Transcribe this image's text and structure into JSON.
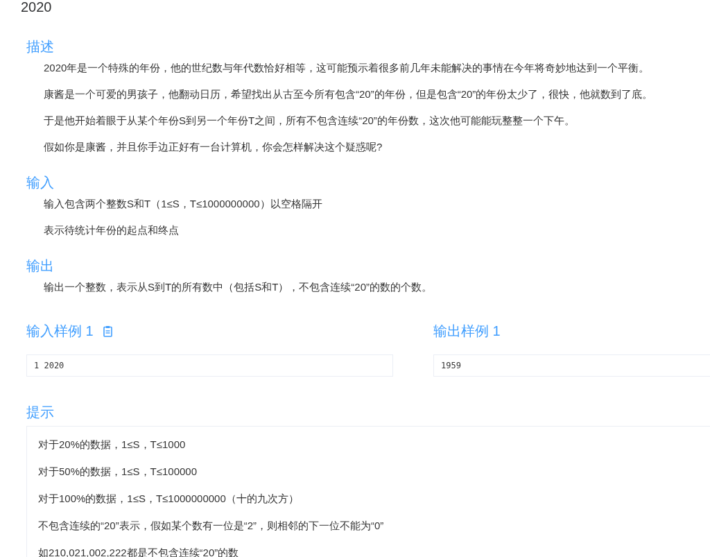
{
  "title": "2020",
  "sections": [
    {
      "heading": "描述",
      "paragraphs": [
        "2020年是一个特殊的年份，他的世纪数与年代数恰好相等，这可能预示着很多前几年未能解决的事情在今年将奇妙地达到一个平衡。",
        "康酱是一个可爱的男孩子，他翻动日历，希望找出从古至今所有包含“20”的年份，但是包含“20”的年份太少了，很快，他就数到了底。",
        "于是他开始着眼于从某个年份S到另一个年份T之间，所有不包含连续“20”的年份数，这次他可能能玩整整一个下午。",
        "假如你是康酱，并且你手边正好有一台计算机，你会怎样解决这个疑惑呢?"
      ]
    },
    {
      "heading": "输入",
      "paragraphs": [
        "输入包含两个整数S和T（1≤S，T≤1000000000）以空格隔开",
        "表示待统计年份的起点和终点"
      ]
    },
    {
      "heading": "输出",
      "paragraphs": [
        "输出一个整数，表示从S到T的所有数中（包括S和T），不包含连续“20”的数的个数。"
      ]
    }
  ],
  "samples": [
    {
      "heading": "输入样例 1",
      "copy_button": true,
      "value": "1 2020"
    },
    {
      "heading": "输出样例 1",
      "copy_button": false,
      "value": "1959"
    }
  ],
  "hint": {
    "heading": "提示",
    "lines": [
      "对于20%的数据，1≤S，T≤1000",
      "对于50%的数据，1≤S，T≤100000",
      "对于100%的数据，1≤S，T≤1000000000（十的九次方）",
      "不包含连续的“20”表示，假如某个数有一位是“2”，则相邻的下一位不能为“0”",
      "如210,021,002,222都是不包含连续“20”的数"
    ]
  }
}
